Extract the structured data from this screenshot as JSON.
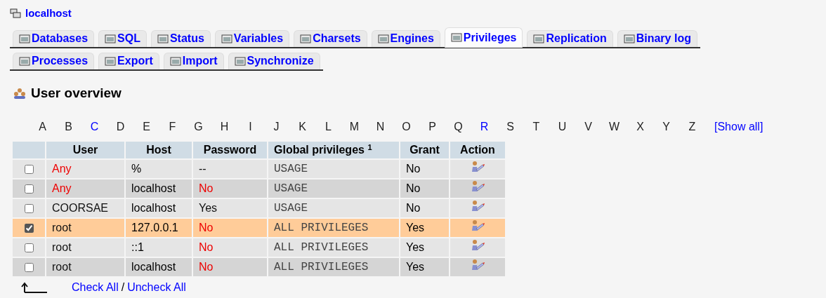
{
  "server": "localhost",
  "tab_rows": [
    [
      {
        "label": "Databases",
        "selected": false
      },
      {
        "label": "SQL",
        "selected": false
      },
      {
        "label": "Status",
        "selected": false
      },
      {
        "label": "Variables",
        "selected": false
      },
      {
        "label": "Charsets",
        "selected": false
      },
      {
        "label": "Engines",
        "selected": false
      },
      {
        "label": "Privileges",
        "selected": true
      },
      {
        "label": "Replication",
        "selected": false
      },
      {
        "label": "Binary log",
        "selected": false
      }
    ],
    [
      {
        "label": "Processes",
        "selected": false
      },
      {
        "label": "Export",
        "selected": false
      },
      {
        "label": "Import",
        "selected": false
      },
      {
        "label": "Synchronize",
        "selected": false
      }
    ]
  ],
  "heading": "User overview",
  "letters": [
    {
      "label": "A",
      "link": false
    },
    {
      "label": "B",
      "link": false
    },
    {
      "label": "C",
      "link": true
    },
    {
      "label": "D",
      "link": false
    },
    {
      "label": "E",
      "link": false
    },
    {
      "label": "F",
      "link": false
    },
    {
      "label": "G",
      "link": false
    },
    {
      "label": "H",
      "link": false
    },
    {
      "label": "I",
      "link": false
    },
    {
      "label": "J",
      "link": false
    },
    {
      "label": "K",
      "link": false
    },
    {
      "label": "L",
      "link": false
    },
    {
      "label": "M",
      "link": false
    },
    {
      "label": "N",
      "link": false
    },
    {
      "label": "O",
      "link": false
    },
    {
      "label": "P",
      "link": false
    },
    {
      "label": "Q",
      "link": false
    },
    {
      "label": "R",
      "link": true
    },
    {
      "label": "S",
      "link": false
    },
    {
      "label": "T",
      "link": false
    },
    {
      "label": "U",
      "link": false
    },
    {
      "label": "V",
      "link": false
    },
    {
      "label": "W",
      "link": false
    },
    {
      "label": "X",
      "link": false
    },
    {
      "label": "Y",
      "link": false
    },
    {
      "label": "Z",
      "link": false
    }
  ],
  "show_all": "[Show all]",
  "table": {
    "columns": [
      "User",
      "Host",
      "Password",
      "Global privileges",
      "Grant",
      "Action"
    ],
    "footnote_mark": "1",
    "rows": [
      {
        "checked": false,
        "user": "Any",
        "user_anonymous": true,
        "host": "%",
        "password": "--",
        "password_warn": false,
        "privileges": "USAGE",
        "grant": "No"
      },
      {
        "checked": false,
        "user": "Any",
        "user_anonymous": true,
        "host": "localhost",
        "password": "No",
        "password_warn": true,
        "privileges": "USAGE",
        "grant": "No"
      },
      {
        "checked": false,
        "user": "COORSAE",
        "user_anonymous": false,
        "host": "localhost",
        "password": "Yes",
        "password_warn": false,
        "privileges": "USAGE",
        "grant": "No"
      },
      {
        "checked": true,
        "user": "root",
        "user_anonymous": false,
        "host": "127.0.0.1",
        "password": "No",
        "password_warn": true,
        "privileges": "ALL PRIVILEGES",
        "grant": "Yes"
      },
      {
        "checked": false,
        "user": "root",
        "user_anonymous": false,
        "host": "::1",
        "password": "No",
        "password_warn": true,
        "privileges": "ALL PRIVILEGES",
        "grant": "Yes"
      },
      {
        "checked": false,
        "user": "root",
        "user_anonymous": false,
        "host": "localhost",
        "password": "No",
        "password_warn": true,
        "privileges": "ALL PRIVILEGES",
        "grant": "Yes"
      }
    ]
  },
  "check_all": "Check All",
  "separator": "/",
  "uncheck_all": "Uncheck All"
}
